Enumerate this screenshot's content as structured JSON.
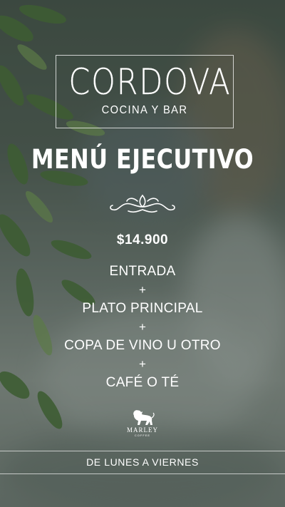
{
  "brand": {
    "name": "CORDOVA",
    "subtitle": "COCINA Y BAR"
  },
  "menu": {
    "title": "MENÚ EJECUTIVO",
    "price": "$14.900",
    "items": [
      "ENTRADA",
      "PLATO PRINCIPAL",
      "COPA DE VINO U OTRO",
      "CAFÉ O TÉ"
    ],
    "separator": "+"
  },
  "sponsor": {
    "name": "MARLEY",
    "sub": "COFFEE"
  },
  "schedule": {
    "days": "DE LUNES A VIERNES"
  },
  "colors": {
    "text": "#ffffff",
    "overlay": "#3c4842",
    "leaf": "#3f6a2b"
  },
  "icons": [
    "ornament-icon",
    "lion-logo-icon"
  ]
}
